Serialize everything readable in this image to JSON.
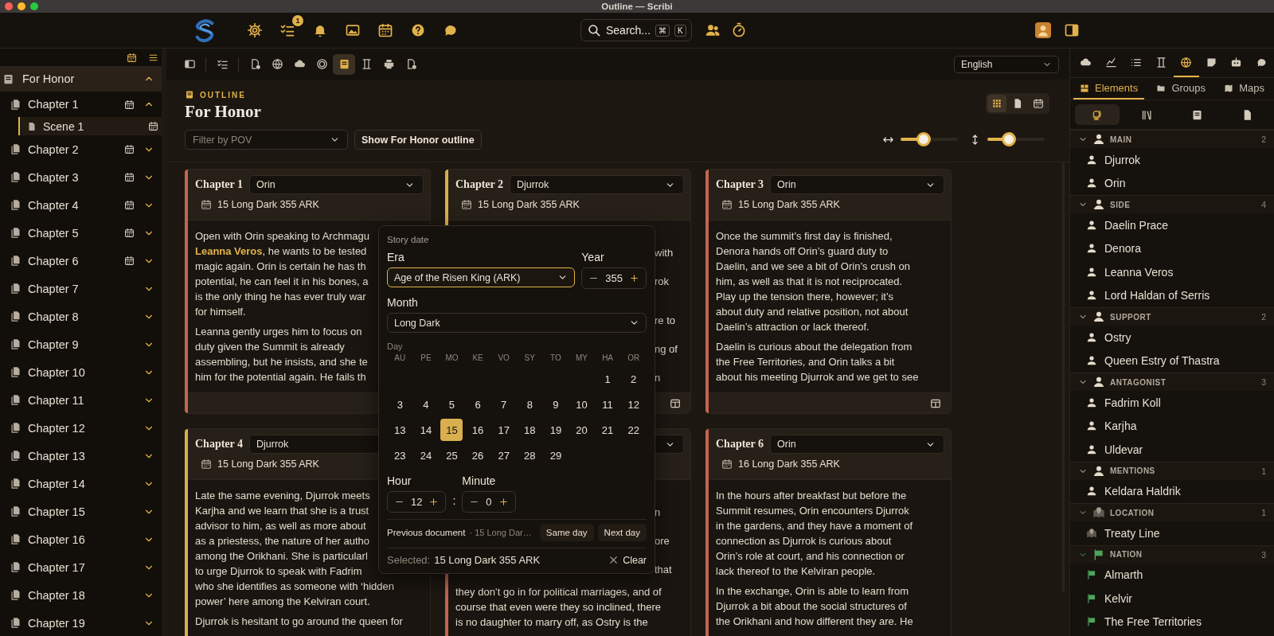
{
  "window": {
    "title": "Outline — Scribi"
  },
  "toolbar": {
    "items": [
      {
        "kind": "settings"
      },
      {
        "kind": "tasks",
        "badge": "1"
      },
      {
        "kind": "bell"
      },
      {
        "kind": "image"
      },
      {
        "kind": "calendar"
      },
      {
        "kind": "help"
      },
      {
        "kind": "chat"
      }
    ],
    "search": {
      "label": "Search...",
      "keys": [
        "⌘",
        "K"
      ]
    },
    "right_items": [
      {
        "kind": "people"
      },
      {
        "kind": "timer"
      }
    ],
    "end_items": [
      {
        "kind": "avatar"
      },
      {
        "kind": "panel"
      }
    ]
  },
  "sidebar": {
    "tree": [
      {
        "label": "For Honor",
        "expanded": true,
        "children": [
          {
            "label": "Chapter 1",
            "dated": true,
            "selected": false,
            "expanded": true,
            "children": [
              {
                "label": "Scene 1",
                "dated": true,
                "selected": true
              }
            ]
          },
          {
            "label": "Chapter 2",
            "dated": true,
            "selected": false,
            "expanded": false
          },
          {
            "label": "Chapter 3",
            "dated": true,
            "selected": false,
            "expanded": false
          },
          {
            "label": "Chapter 4",
            "dated": true,
            "selected": false,
            "expanded": false
          },
          {
            "label": "Chapter 5",
            "dated": true,
            "selected": false,
            "expanded": false
          },
          {
            "label": "Chapter 6",
            "dated": true,
            "selected": false,
            "expanded": false
          },
          {
            "label": "Chapter 7",
            "dated": false,
            "selected": false,
            "expanded": false
          },
          {
            "label": "Chapter 8",
            "dated": false,
            "selected": false,
            "expanded": false
          },
          {
            "label": "Chapter 9",
            "dated": false,
            "selected": false,
            "expanded": false
          },
          {
            "label": "Chapter 10",
            "dated": false,
            "selected": false,
            "expanded": false
          },
          {
            "label": "Chapter 11",
            "dated": false,
            "selected": false,
            "expanded": false
          },
          {
            "label": "Chapter 12",
            "dated": false,
            "selected": false,
            "expanded": false
          },
          {
            "label": "Chapter 13",
            "dated": false,
            "selected": false,
            "expanded": false
          },
          {
            "label": "Chapter 14",
            "dated": false,
            "selected": false,
            "expanded": false
          },
          {
            "label": "Chapter 15",
            "dated": false,
            "selected": false,
            "expanded": false
          },
          {
            "label": "Chapter 16",
            "dated": false,
            "selected": false,
            "expanded": false
          },
          {
            "label": "Chapter 17",
            "dated": false,
            "selected": false,
            "expanded": false
          },
          {
            "label": "Chapter 18",
            "dated": false,
            "selected": false,
            "expanded": false
          },
          {
            "label": "Chapter 19",
            "dated": false,
            "selected": false,
            "expanded": false
          }
        ]
      }
    ]
  },
  "editor_toolbar": {
    "tool_groups": [
      [
        {
          "kind": "sidebar",
          "selected": false
        }
      ],
      [
        {
          "kind": "tasks",
          "selected": false
        }
      ],
      [
        {
          "kind": "doc-settings",
          "selected": false
        },
        {
          "kind": "globe",
          "selected": false
        },
        {
          "kind": "cloud",
          "selected": false
        },
        {
          "kind": "target",
          "selected": false
        },
        {
          "kind": "book",
          "selected": true
        },
        {
          "kind": "columns",
          "selected": false
        },
        {
          "kind": "printer",
          "selected": false
        },
        {
          "kind": "doc-settings",
          "selected": false
        }
      ]
    ],
    "language": "English"
  },
  "outline": {
    "label": "OUTLINE",
    "title": "For Honor",
    "filter_placeholder": "Filter by POV",
    "show_button": "Show For Honor outline",
    "views": [
      {
        "kind": "grid",
        "selected": true
      },
      {
        "kind": "doc",
        "selected": false
      },
      {
        "kind": "calendar",
        "selected": false
      }
    ],
    "width_slider": {
      "level": 0.4
    },
    "height_slider": {
      "level": 0.37
    }
  },
  "cards": [
    {
      "title": "Chapter 1",
      "pov": "Orin",
      "date": "15 Long Dark 355 ARK",
      "color": "#c4654f",
      "footer": true,
      "layout_icon": false,
      "paragraphs": [
        {
          "kind": "text",
          "lines": [
            "Open with Orin speaking to Archmagu",
            "**Leanna Veros**, he wants to be tested",
            "magic again. Orin is certain he has th",
            "potential, he can feel it in his bones, a",
            "is the only thing he has ever truly war",
            "for himself."
          ]
        },
        {
          "kind": "text",
          "lines": [
            "Leanna gently urges him to focus on",
            "duty given the Summit is already",
            "assembling, but he insists, and she te",
            "him for the potential again. He fails th"
          ]
        }
      ]
    },
    {
      "title": "Chapter 2",
      "pov": "Djurrok",
      "date": "15 Long Dark 355 ARK",
      "color": "#d8b04a",
      "footer": true,
      "layout_icon": true,
      "paragraphs": [
        {
          "kind": "fragments",
          "lines": [
            "with",
            "rok"
          ]
        },
        {
          "kind": "fragments",
          "lines": [
            "re to",
            "ng of",
            "n"
          ]
        }
      ]
    },
    {
      "title": "Chapter 3",
      "pov": "Orin",
      "date": "15 Long Dark 355 ARK",
      "color": "#c4654f",
      "footer": true,
      "layout_icon": true,
      "paragraphs": [
        {
          "kind": "text",
          "lines": [
            "Once the summit’s first day is finished,",
            "Denora hands off Orin’s guard duty to",
            "Daelin, and we see a bit of Orin’s crush on",
            "him, as well as that it is not reciprocated.",
            "Play up the tension there, however; it’s",
            "about duty and relative position, not about",
            "Daelin’s attraction or lack thereof."
          ]
        },
        {
          "kind": "text",
          "lines": [
            "Daelin is curious about the delegation from",
            "the Free Territories, and Orin talks a bit",
            "about his meeting Djurrok and we get to see"
          ]
        }
      ]
    },
    {
      "title": "Chapter 4",
      "pov": "Djurrok",
      "date": "15 Long Dark 355 ARK",
      "color": "#d8b04a",
      "footer": false,
      "paragraphs": [
        {
          "kind": "text",
          "lines": [
            "Late the same evening, Djurrok meets",
            "Karjha and we learn that she is a trust",
            "advisor to him, as well as more about",
            "as a priestess, the nature of her autho",
            "among the Orikhani. She is particularl",
            "to urge Djurrok to speak with Fadrim"
          ]
        },
        {
          "kind": "continuation",
          "lines": [
            "who she identifies as someone with ‘hidden",
            "power’ here among the Kelviran court."
          ]
        },
        {
          "kind": "text",
          "lines": [
            "Djurrok is hesitant to go around the queen for"
          ]
        }
      ]
    },
    {
      "color": "#c4654f",
      "footer": false,
      "paragraphs": [
        {
          "kind": "fragments",
          "lines": [
            "n",
            "ore",
            "that"
          ]
        },
        {
          "kind": "text",
          "lines": [
            "they don’t go in for political marriages, and of",
            "course that even were they so inclined, there",
            "is no daughter to marry off, as Ostry is the"
          ]
        }
      ]
    },
    {
      "title": "Chapter 6",
      "pov": "Orin",
      "date": "16 Long Dark 355 ARK",
      "color": "#c4654f",
      "footer": false,
      "paragraphs": [
        {
          "kind": "text",
          "lines": [
            "In the hours after breakfast but before the",
            "Summit resumes, Orin encounters Djurrok",
            "in the gardens, and they have a moment of",
            "connection as Djurrok is curious about",
            "Orin’s role at court, and his connection or",
            "lack thereof to the Kelviran people."
          ]
        },
        {
          "kind": "text",
          "lines": [
            "In the exchange, Orin is able to learn from",
            "Djurrok a bit about the social structures of",
            "the Orikhani and how different they are. He"
          ]
        }
      ]
    }
  ],
  "date_picker": {
    "title": "Story date",
    "era_label": "Era",
    "era": "Age of the Risen King (ARK)",
    "year_label": "Year",
    "year": "355",
    "month_label": "Month",
    "month": "Long Dark",
    "day_label": "Day",
    "weekdays": [
      "AU",
      "PE",
      "MO",
      "KE",
      "VO",
      "SY",
      "TO",
      "MY",
      "HA",
      "OR"
    ],
    "weeks": [
      {
        "kind": "end",
        "days": [
          {
            "label": "1",
            "selected": false
          },
          {
            "label": "2",
            "selected": false
          }
        ]
      },
      {
        "kind": "start",
        "days": [
          {
            "label": "3",
            "selected": false
          },
          {
            "label": "4",
            "selected": false
          },
          {
            "label": "5",
            "selected": false
          },
          {
            "label": "6",
            "selected": false
          },
          {
            "label": "7",
            "selected": false
          },
          {
            "label": "8",
            "selected": false
          },
          {
            "label": "9",
            "selected": false
          },
          {
            "label": "10",
            "selected": false
          },
          {
            "label": "11",
            "selected": false
          },
          {
            "label": "12",
            "selected": false
          }
        ]
      },
      {
        "kind": "start",
        "days": [
          {
            "label": "13",
            "selected": false
          },
          {
            "label": "14",
            "selected": false
          },
          {
            "label": "15",
            "selected": true
          },
          {
            "label": "16",
            "selected": false
          },
          {
            "label": "17",
            "selected": false
          },
          {
            "label": "18",
            "selected": false
          },
          {
            "label": "19",
            "selected": false
          },
          {
            "label": "20",
            "selected": false
          },
          {
            "label": "21",
            "selected": false
          },
          {
            "label": "22",
            "selected": false
          }
        ]
      },
      {
        "kind": "start",
        "days": [
          {
            "label": "23",
            "selected": false
          },
          {
            "label": "24",
            "selected": false
          },
          {
            "label": "25",
            "selected": false
          },
          {
            "label": "26",
            "selected": false
          },
          {
            "label": "27",
            "selected": false
          },
          {
            "label": "28",
            "selected": false
          },
          {
            "label": "29",
            "selected": false
          }
        ]
      }
    ],
    "hour_label": "Hour",
    "hour": "12",
    "separator": ":",
    "minute_label": "Minute",
    "minute": "0",
    "previous_label": "Previous document",
    "previous_detail": "· 15 Long Dar…",
    "buttons": [
      "Same day",
      "Next day"
    ],
    "selected_label": "Selected:",
    "selected_value": "15 Long Dark 355 ARK",
    "clear": "Clear"
  },
  "right_panel": {
    "tabs": [
      {
        "kind": "cloud",
        "selected": false
      },
      {
        "kind": "chart",
        "selected": false
      },
      {
        "kind": "list",
        "selected": false
      },
      {
        "kind": "columns",
        "selected": false
      },
      {
        "kind": "globe",
        "selected": true
      },
      {
        "kind": "note",
        "selected": false
      },
      {
        "kind": "robot",
        "selected": false
      },
      {
        "kind": "chat",
        "selected": false
      }
    ],
    "subtabs": [
      {
        "kind": "elements",
        "label": "Elements",
        "selected": true
      },
      {
        "kind": "folder",
        "label": "Groups",
        "selected": false
      },
      {
        "kind": "map",
        "label": "Maps",
        "selected": false
      }
    ],
    "filters": [
      {
        "kind": "globe-stand",
        "selected": true
      },
      {
        "kind": "books",
        "selected": false
      },
      {
        "kind": "book",
        "selected": false
      },
      {
        "kind": "doc",
        "selected": false
      }
    ],
    "groups": [
      {
        "label": "MAIN",
        "count": "2",
        "kind": "person",
        "expanded": true,
        "items": [
          "Djurrok",
          "Orin"
        ]
      },
      {
        "label": "SIDE",
        "count": "4",
        "kind": "person",
        "expanded": true,
        "items": [
          "Daelin Prace",
          "Denora",
          "Leanna Veros",
          "Lord Haldan of Serris"
        ]
      },
      {
        "label": "SUPPORT",
        "count": "2",
        "kind": "person",
        "expanded": true,
        "items": [
          "Ostry",
          "Queen Estry of Thastra"
        ]
      },
      {
        "label": "ANTAGONIST",
        "count": "3",
        "kind": "person",
        "expanded": true,
        "items": [
          "Fadrim Koll",
          "Karjha",
          "Uldevar"
        ]
      },
      {
        "label": "MENTIONS",
        "count": "1",
        "kind": "person",
        "expanded": true,
        "items": [
          "Keldara Haldrik"
        ]
      },
      {
        "label": "LOCATION",
        "count": "1",
        "kind": "location",
        "expanded": true,
        "items": [
          "Treaty Line"
        ]
      },
      {
        "label": "NATION",
        "count": "3",
        "kind": "nation",
        "expanded": true,
        "items": [
          "Almarth",
          "Kelvir",
          "The Free Territories"
        ]
      }
    ]
  }
}
